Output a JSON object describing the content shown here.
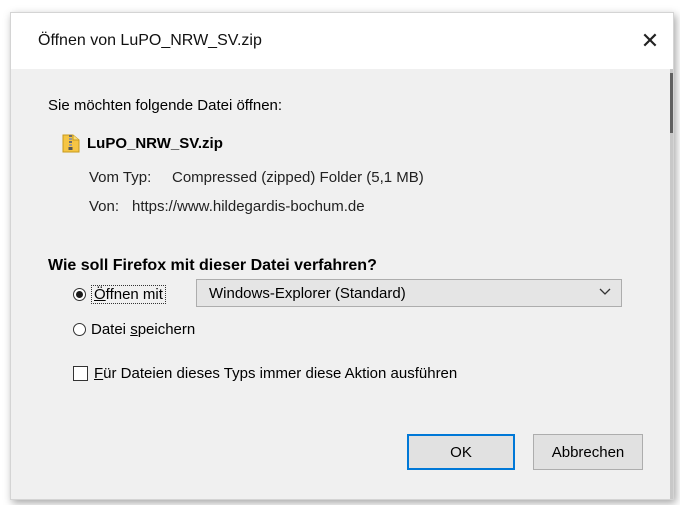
{
  "dialog": {
    "title": "Öffnen von LuPO_NRW_SV.zip",
    "close_icon": "close-icon",
    "close_glyph": "✕"
  },
  "file": {
    "prompt": "Sie möchten folgende Datei öffnen:",
    "icon": "zip-folder-icon",
    "name": "LuPO_NRW_SV.zip",
    "type_label": "Vom Typ:",
    "type_value": "Compressed (zipped) Folder (5,1 MB)",
    "from_label": "Von:",
    "from_value": "https://www.hildegardis-bochum.de"
  },
  "action": {
    "question": "Wie soll Firefox mit dieser Datei verfahren?",
    "open_with": {
      "mnemonic": "Ö",
      "rest": "ffnen mit",
      "selected": true
    },
    "app_select": {
      "value": "Windows-Explorer (Standard)",
      "icon": "chevron-down-icon"
    },
    "save_file": {
      "pre": "Datei ",
      "mnemonic": "s",
      "rest": "peichern",
      "selected": false
    },
    "always": {
      "mnemonic": "F",
      "rest": "ür Dateien dieses Typs immer diese Aktion ausführen",
      "checked": false
    }
  },
  "buttons": {
    "ok": "OK",
    "cancel": "Abbrechen"
  },
  "colors": {
    "accent": "#0078d7",
    "content_bg": "#f0f0f0",
    "button_bg": "#e1e1e1"
  }
}
